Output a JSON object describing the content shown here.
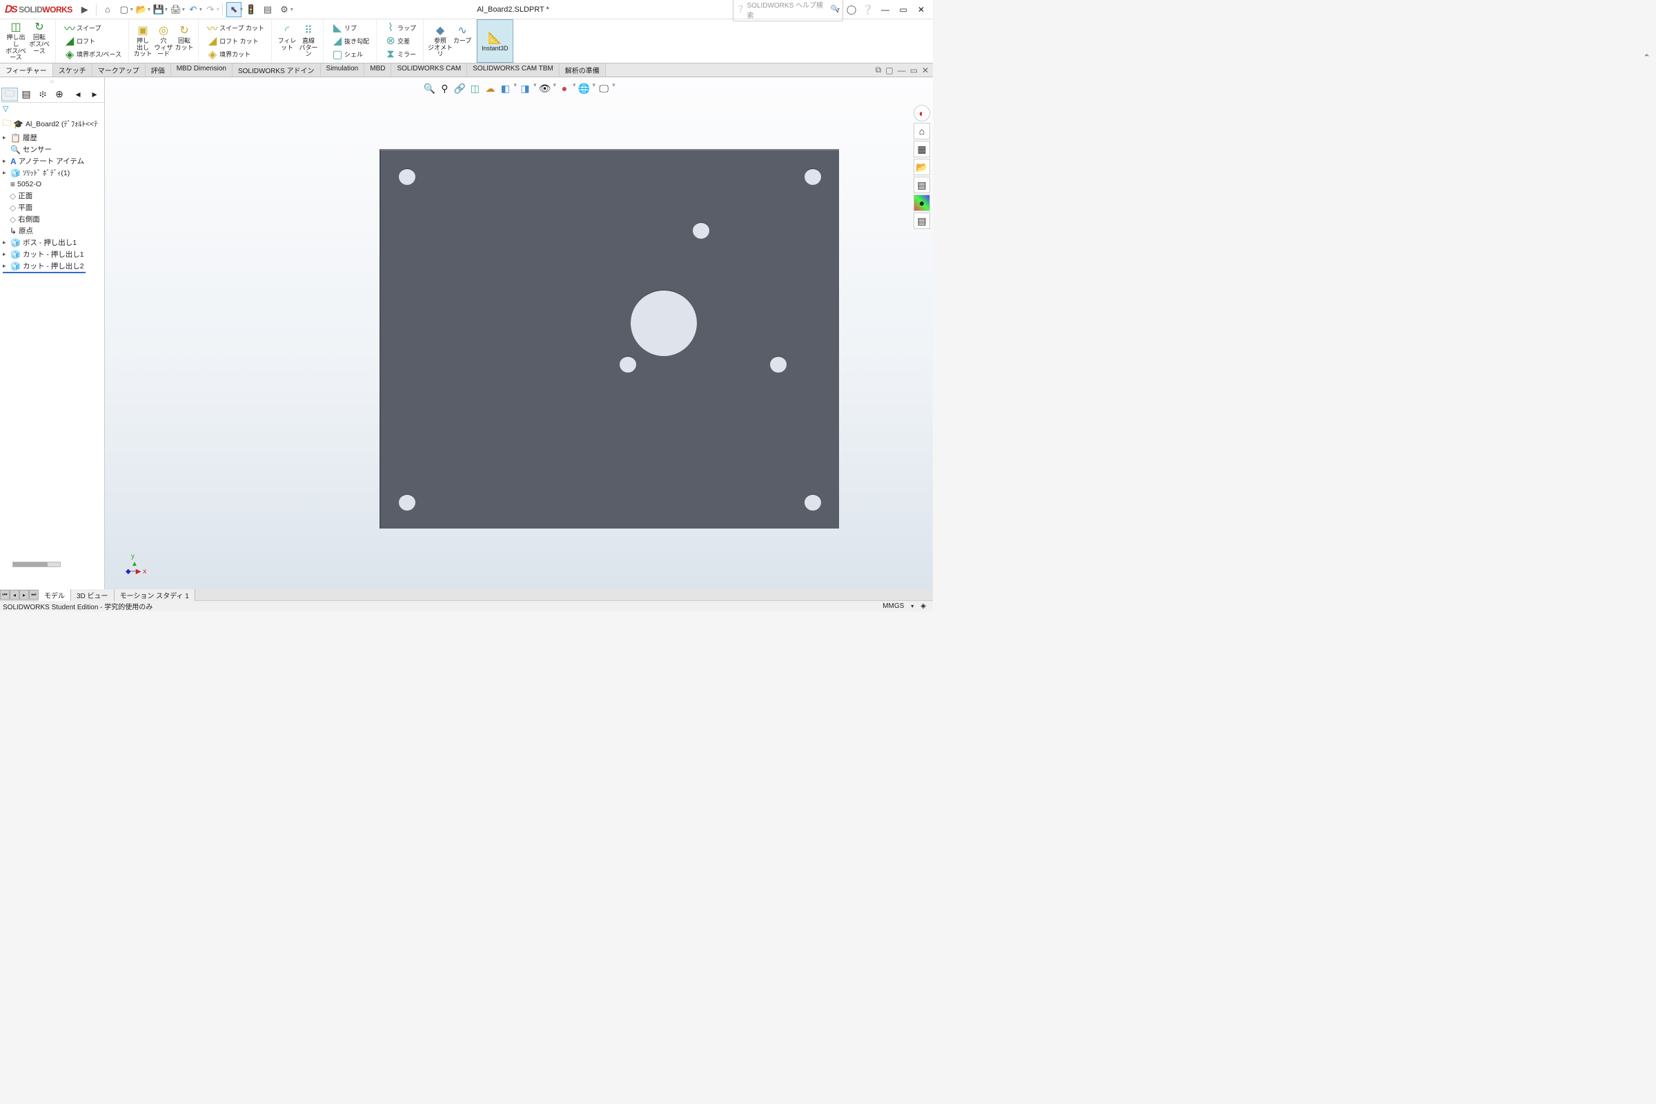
{
  "app": {
    "name_solid": "SOLID",
    "name_works": "WORKS",
    "title": "Al_Board2.SLDPRT *",
    "search_placeholder": "SOLIDWORKS ヘルプ検索"
  },
  "ribbon": {
    "extrude_boss": "押し出し\nボス/ベース",
    "revolve_boss": "回転\nボス/ベース",
    "sweep": "スイープ",
    "loft": "ロフト",
    "boundary": "境界ボス/ベース",
    "extrude_cut": "押し\n出し\nカット",
    "hole": "穴\nウィザード",
    "revolve_cut": "回転\nカット",
    "sweep_cut": "スイープ カット",
    "loft_cut": "ロフト カット",
    "boundary_cut": "境界カット",
    "fillet": "フィレット",
    "pattern": "直線\nパターン",
    "rib": "リブ",
    "draft": "抜き勾配",
    "shell": "シェル",
    "wrap": "ラップ",
    "intersect": "交差",
    "mirror": "ミラー",
    "ref_geom": "参照\nジオメトリ",
    "curves": "カーブ",
    "instant3d": "Instant3D"
  },
  "tabs": [
    "フィーチャー",
    "スケッチ",
    "マークアップ",
    "評価",
    "MBD Dimension",
    "SOLIDWORKS アドイン",
    "Simulation",
    "MBD",
    "SOLIDWORKS CAM",
    "SOLIDWORKS CAM TBM",
    "解析の準備"
  ],
  "tree": {
    "root": "Al_Board2 (ﾃﾞﾌｫﾙﾄ<<ﾃ",
    "items": [
      {
        "icon": "📋",
        "label": "履歴",
        "exp": "▸"
      },
      {
        "icon": "🔍",
        "label": "センサー",
        "exp": ""
      },
      {
        "icon": "A",
        "label": "アノテート アイテム",
        "exp": "▸"
      },
      {
        "icon": "🧊",
        "label": "ｿﾘｯﾄﾞ ﾎﾞﾃﾞｨ(1)",
        "exp": "▸"
      },
      {
        "icon": "≡",
        "label": "5052-O",
        "exp": ""
      },
      {
        "icon": "◇",
        "label": "正面",
        "exp": "",
        "indent": true
      },
      {
        "icon": "◇",
        "label": "平面",
        "exp": "",
        "indent": true
      },
      {
        "icon": "◇",
        "label": "右側面",
        "exp": "",
        "indent": true
      },
      {
        "icon": "↳",
        "label": "原点",
        "exp": "",
        "indent": true
      },
      {
        "icon": "🧊",
        "label": "ボス - 押し出し1",
        "exp": "▸"
      },
      {
        "icon": "🧊",
        "label": "カット - 押し出し1",
        "exp": "▸"
      },
      {
        "icon": "🧊",
        "label": "カット - 押し出し2",
        "exp": "▸"
      }
    ]
  },
  "bottom_tabs": [
    "モデル",
    "3D ビュー",
    "モーション スタディ 1"
  ],
  "status": {
    "left": "SOLIDWORKS Student Edition - 学究的使用のみ",
    "units": "MMGS"
  }
}
